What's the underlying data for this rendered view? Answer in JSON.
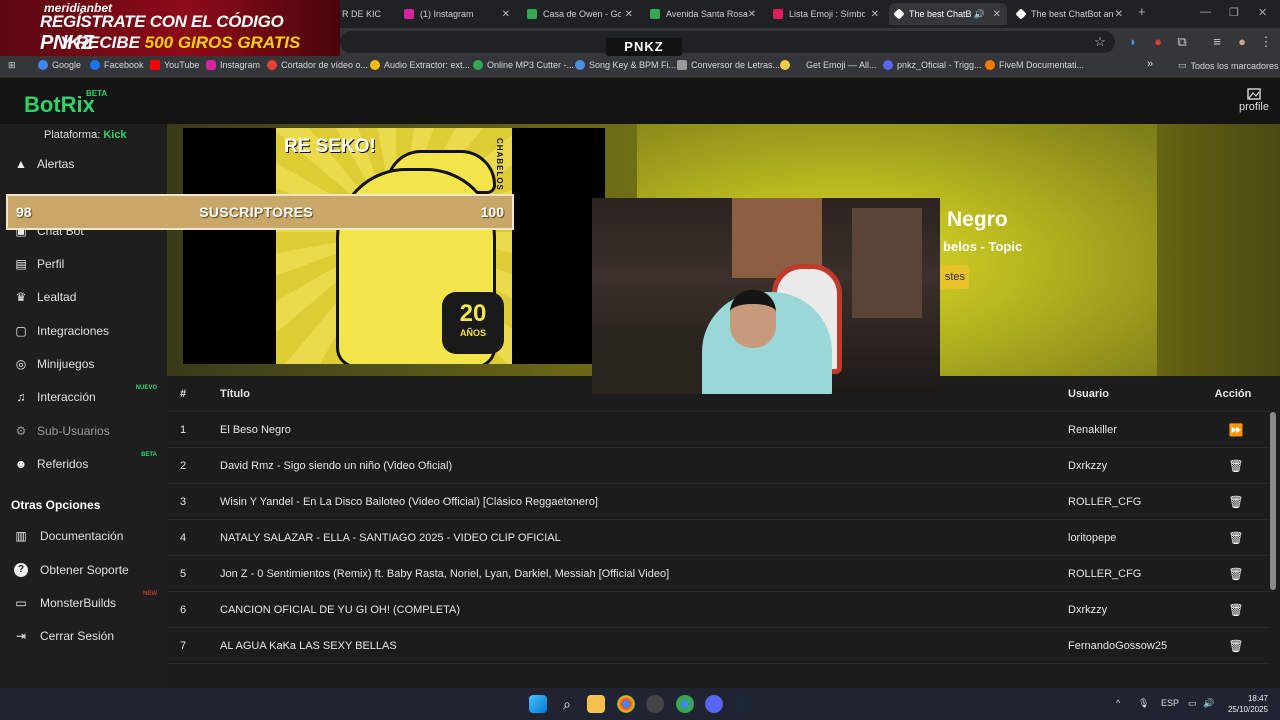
{
  "browser": {
    "tabs": [
      {
        "label": "R DE KIC",
        "color": "#ffffff"
      },
      {
        "label": "(1) Instagram",
        "color": "#d6249f"
      },
      {
        "label": "Casa de Owen - Goo",
        "color": "#34a853"
      },
      {
        "label": "Avenida Santa Rosa",
        "color": "#34a853"
      },
      {
        "label": "Lista Emoji : Símbolo",
        "color": "#e01e5a"
      },
      {
        "label": "The best ChatBot",
        "color": "#ffffff"
      },
      {
        "label": "The best ChatBot an",
        "color": "#ffffff"
      }
    ],
    "new_tab": "+",
    "bookmarks": [
      {
        "label": "Google",
        "color": "#4285f4"
      },
      {
        "label": "Facebook",
        "color": "#1877f2"
      },
      {
        "label": "YouTube",
        "color": "#ff0000"
      },
      {
        "label": "Instagram",
        "color": "#d6249f"
      },
      {
        "label": "Cortador de vídeo o...",
        "color": "#ea4335"
      },
      {
        "label": "Audio Extractor: ext...",
        "color": "#fbbc05"
      },
      {
        "label": "Online MP3 Cutter -...",
        "color": "#34a853"
      },
      {
        "label": "Song Key & BPM Fi...",
        "color": "#4a90e2"
      },
      {
        "label": "Conversor de Letras...",
        "color": "#999999"
      },
      {
        "label": "Get Emoji — All...",
        "color": "#f7c948"
      },
      {
        "label": "pnkz_Oficial - Trigg...",
        "color": "#5865f2"
      },
      {
        "label": "FiveM Documentati...",
        "color": "#f57c00"
      }
    ],
    "all_bookmarks": "Todos los marcadores"
  },
  "ad": {
    "brand": "meridianbet",
    "line1": "REGÍSTRATE CON EL CÓDIGO",
    "code": "PNKZ",
    "line2_prefix": "Y RECIBE",
    "line2_highlight": "500 GIROS GRATIS"
  },
  "stream_logo": "PNKZ",
  "app": {
    "brand": "BotRix",
    "brand_badge": "BETA",
    "profile_label": "profile"
  },
  "sidebar": {
    "platform_label": "Plataforma:",
    "platform_value": "Kick",
    "items": [
      {
        "label": "Alertas",
        "icon": "warning-icon"
      },
      {
        "label": "Chat Bot",
        "icon": "robot-icon"
      },
      {
        "label": "Perfil",
        "icon": "id-card-icon"
      },
      {
        "label": "Lealtad",
        "icon": "trophy-icon"
      },
      {
        "label": "Integraciones",
        "icon": "plug-icon"
      },
      {
        "label": "Minijuegos",
        "icon": "gamepad-icon"
      },
      {
        "label": "Interacción",
        "icon": "music-icon",
        "badge": "NUEVO"
      },
      {
        "label": "Sub-Usuarios",
        "icon": "users-cog-icon"
      },
      {
        "label": "Referidos",
        "icon": "users-icon",
        "badge": "BETA"
      }
    ],
    "section_title": "Otras Opciones",
    "other": [
      {
        "label": "Documentación",
        "icon": "book-icon"
      },
      {
        "label": "Obtener Soporte",
        "icon": "question-icon"
      },
      {
        "label": "MonsterBuilds",
        "icon": "monitor-icon",
        "badge": "NEW"
      },
      {
        "label": "Cerrar Sesión",
        "icon": "logout-icon"
      }
    ]
  },
  "now_playing": {
    "title": "Negro",
    "artist": "belos - Topic",
    "button": "stes",
    "album_text": "RE SEKO!",
    "album_side": "CHABELOS",
    "album_seal_number": "20",
    "album_seal_text": "AÑOS"
  },
  "sub_goal": {
    "current": "98",
    "label": "SUSCRIPTORES",
    "target": "100",
    "progress": 0.98
  },
  "queue": {
    "headers": {
      "num": "#",
      "title": "Título",
      "user": "Usuario",
      "action": "Acción"
    },
    "rows": [
      {
        "num": "1",
        "title": "El Beso Negro",
        "user": "Renakiller",
        "action": "skip"
      },
      {
        "num": "2",
        "title": "David Rmz - Sigo siendo un niño (Video Oficial)",
        "user": "Dxrkzzy",
        "action": "delete"
      },
      {
        "num": "3",
        "title": "Wisin Y Yandel - En La Disco Bailoteo (Video Official) [Clásico Reggaetonero]",
        "user": "ROLLER_CFG",
        "action": "delete"
      },
      {
        "num": "4",
        "title": "NATALY SALAZAR - ELLA - SANTIAGO 2025 - VIDEO CLIP OFICIAL",
        "user": "loritopepe",
        "action": "delete"
      },
      {
        "num": "5",
        "title": "Jon Z - 0 Sentimientos (Remix) ft. Baby Rasta, Noriel, Lyan, Darkiel, Messiah [Official Video]",
        "user": "ROLLER_CFG",
        "action": "delete"
      },
      {
        "num": "6",
        "title": "CANCION OFICIAL DE YU GI OH! (COMPLETA)",
        "user": "Dxrkzzy",
        "action": "delete"
      },
      {
        "num": "7",
        "title": "AL AGUA KaKa LAS SEXY BELLAS",
        "user": "FernandoGossow25",
        "action": "delete"
      }
    ]
  },
  "taskbar": {
    "lang": "ESP",
    "time": "18:47",
    "date": "25/10/2025"
  }
}
